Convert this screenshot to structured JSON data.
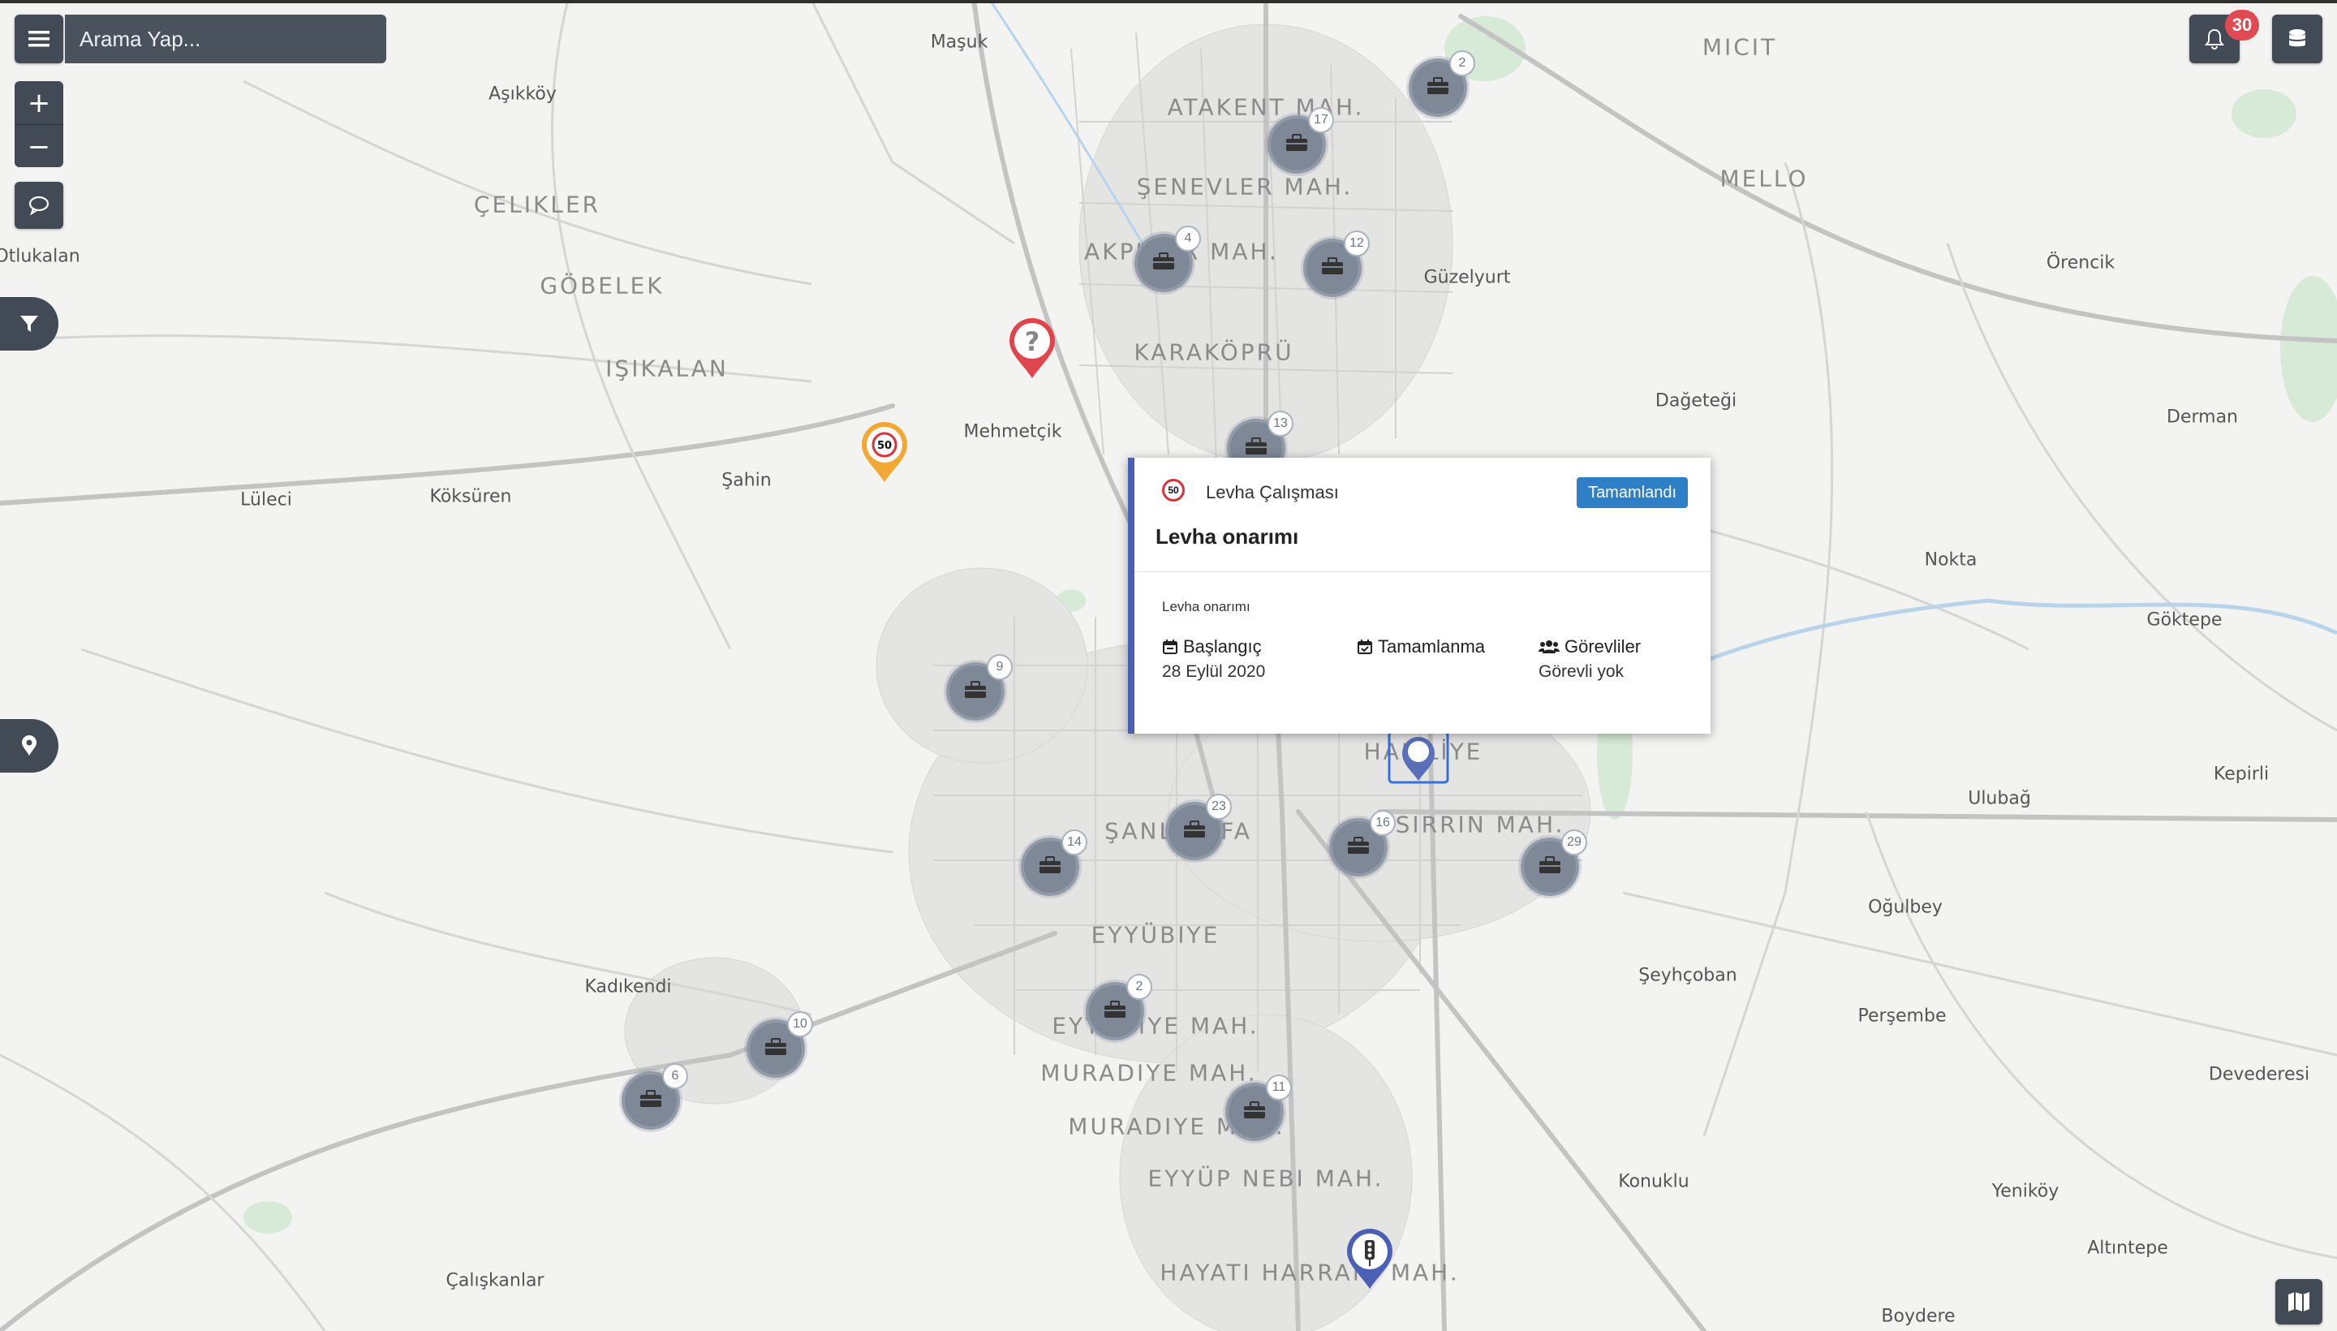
{
  "search": {
    "placeholder": "Arama Yap..."
  },
  "notifications": {
    "count": "30"
  },
  "colors": {
    "control_bg": "#424a55",
    "badge": "#e04a52",
    "status": "#2f7fc6",
    "accent": "#4b5fb5"
  },
  "icons": [
    "menu-icon",
    "plus-icon",
    "minus-icon",
    "comment-icon",
    "filter-icon",
    "map-marker-icon",
    "bell-icon",
    "database-icon",
    "map-icon",
    "toolbox-icon",
    "calendar-icon",
    "calendar-check-icon",
    "users-icon"
  ],
  "map_labels_major": [
    "MICIT",
    "MELLO",
    "ATAKENT MAH.",
    "ŞENEVLER MAH.",
    "ÇELIKLER",
    "GÖBELEK",
    "AKPINAR MAH.",
    "KARAKÖPRÜ",
    "IŞIKALAN",
    "HALİLİYE",
    "SIRRIN MAH.",
    "ŞANLIURFA",
    "EYYÜBIYE",
    "EYYÜBIYE MAH.",
    "MURADIYE MAH.",
    "MURADIYE MAH.",
    "EYYÜP NEBI MAH.",
    "HAYATI HARRANİ MAH."
  ],
  "map_labels_minor": [
    "Maşuk",
    "Aşıkköy",
    "Otlukalan",
    "Güzelyurt",
    "Örencik",
    "Dağeteği",
    "Derman",
    "Mehmetçik",
    "Şahin",
    "Lüleci",
    "Köksüren",
    "Nokta",
    "Göktepe",
    "Kepirli",
    "Ulubağ",
    "Oğulbey",
    "Şeyhçoban",
    "Perşembe",
    "Devederesi",
    "Kadıkendi",
    "Konuklu",
    "Yeniköy",
    "Altıntepe",
    "Çalışkanlar",
    "Boydere"
  ],
  "clusters": [
    {
      "count": "2"
    },
    {
      "count": "17"
    },
    {
      "count": "4"
    },
    {
      "count": "12"
    },
    {
      "count": "13"
    },
    {
      "count": "9"
    },
    {
      "count": "23"
    },
    {
      "count": "16"
    },
    {
      "count": "29"
    },
    {
      "count": "14"
    },
    {
      "count": "2"
    },
    {
      "count": "10"
    },
    {
      "count": "6"
    },
    {
      "count": "11"
    }
  ],
  "speed_sign": "50",
  "popup": {
    "sign": "50",
    "category": "Levha Çalışması",
    "status": "Tamamlandı",
    "title": "Levha onarımı",
    "description": "Levha onarımı",
    "start_label": "Başlangıç",
    "start_value": "28 Eylül 2020",
    "complete_label": "Tamamlanma",
    "complete_value": "",
    "assignees_label": "Görevliler",
    "assignees_value": "Görevli yok"
  }
}
